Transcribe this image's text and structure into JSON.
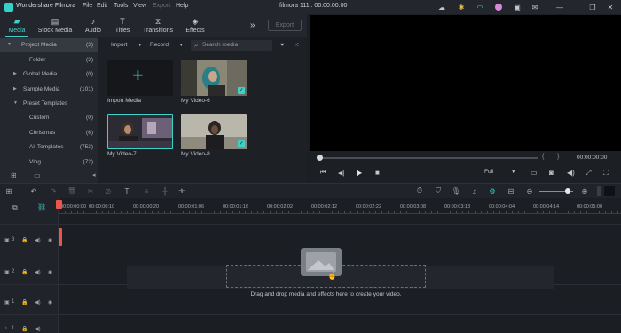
{
  "app": {
    "name": "Wondershare Filmora",
    "project_title": "filmora 111 : 00:00:00:00"
  },
  "menu": [
    "File",
    "Edit",
    "Tools",
    "View",
    "Export",
    "Help"
  ],
  "tabs": [
    {
      "label": "Media",
      "icon": "folder-icon",
      "active": true
    },
    {
      "label": "Stock Media",
      "icon": "stock-media-icon"
    },
    {
      "label": "Audio",
      "icon": "music-note-icon"
    },
    {
      "label": "Titles",
      "icon": "text-t-icon"
    },
    {
      "label": "Transitions",
      "icon": "transition-icon"
    },
    {
      "label": "Effects",
      "icon": "effects-icon"
    }
  ],
  "export_label": "Export",
  "sidebar": [
    {
      "label": "Project Media",
      "count": "(3)",
      "expanded": true,
      "selected": true
    },
    {
      "label": "Folder",
      "count": "(3)",
      "indent": true
    },
    {
      "label": "Global Media",
      "count": "(0)"
    },
    {
      "label": "Sample Media",
      "count": "(101)"
    },
    {
      "label": "Preset Templates",
      "count": "",
      "expanded": true
    },
    {
      "label": "Custom",
      "count": "(0)",
      "indent": true
    },
    {
      "label": "Christmas",
      "count": "(6)",
      "indent": true
    },
    {
      "label": "All Templates",
      "count": "(753)",
      "indent": true
    },
    {
      "label": "Vlog",
      "count": "(72)",
      "indent": true
    }
  ],
  "media_toolbar": {
    "import_label": "Import",
    "record_label": "Record",
    "search_placeholder": "Search media"
  },
  "media_items": [
    {
      "label": "Import Media"
    },
    {
      "label": "My Video-6"
    },
    {
      "label": "My Video-7"
    },
    {
      "label": "My Video-8"
    }
  ],
  "preview": {
    "bracket_left": "{",
    "bracket_right": "}",
    "timecode": "00:00:00:00",
    "quality": "Full"
  },
  "ruler": [
    "00:00:00:00",
    "00:00:00:10",
    "00:00:00:20",
    "00:00:01:06",
    "00:00:01:16",
    "00:00:02:02",
    "00:00:02:12",
    "00:00:02:22",
    "00:00:03:08",
    "00:00:03:18",
    "00:00:04:04",
    "00:00:04:14",
    "00:00:05:00"
  ],
  "tracks": [
    {
      "num": "3"
    },
    {
      "num": "2"
    },
    {
      "num": "1"
    },
    {
      "num": "1"
    }
  ],
  "drop_text": "Drag and drop media and effects here to create your video.",
  "colors": {
    "accent": "#3fd0c7",
    "playhead": "#e8574a"
  }
}
